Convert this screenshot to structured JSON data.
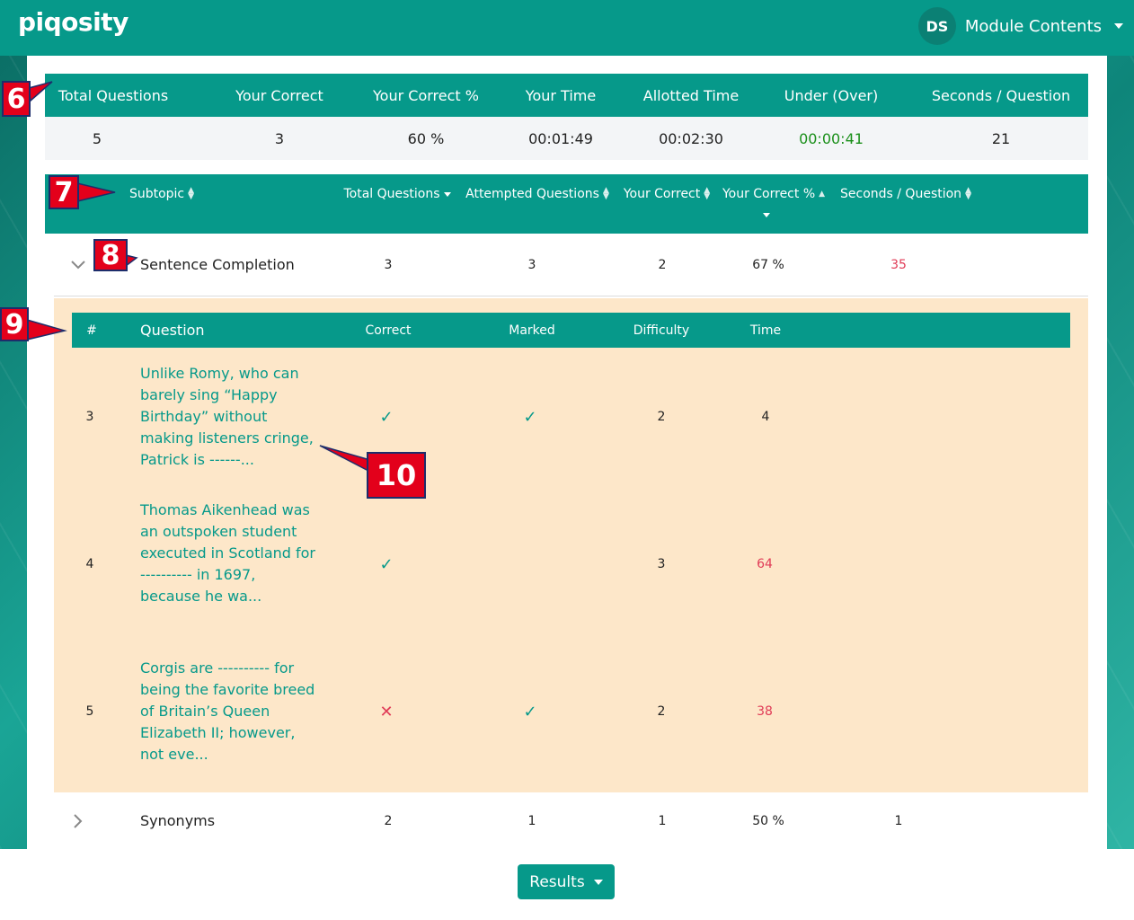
{
  "header": {
    "logo": "piqosity",
    "avatar_initials": "DS",
    "menu_label": "Module Contents"
  },
  "summary": {
    "columns": [
      "Total Questions",
      "Your Correct",
      "Your Correct %",
      "Your Time",
      "Allotted Time",
      "Under (Over)",
      "Seconds / Question"
    ],
    "values": [
      "5",
      "3",
      "60 %",
      "00:01:49",
      "00:02:30",
      "00:00:41",
      "21"
    ]
  },
  "subtopics": {
    "columns": [
      "Subtopic",
      "Total Questions",
      "Attempted Questions",
      "Your Correct",
      "Your Correct %",
      "Seconds / Question"
    ],
    "rows": [
      {
        "name": "Sentence Completion",
        "total": "3",
        "attempted": "3",
        "correct": "2",
        "percent": "67 %",
        "spq": "35"
      },
      {
        "name": "Synonyms",
        "total": "2",
        "attempted": "1",
        "correct": "1",
        "percent": "50 %",
        "spq": "1"
      }
    ]
  },
  "questions": {
    "columns": [
      "#",
      "Question",
      "Correct",
      "Marked",
      "Difficulty",
      "Time"
    ],
    "rows": [
      {
        "num": "3",
        "text": "Unlike Romy, who can barely sing “Happy Birthday” without making listeners cringe, Patrick is ------...",
        "correct": "check",
        "marked": "check",
        "difficulty": "2",
        "time": "4"
      },
      {
        "num": "4",
        "text": "Thomas Aikenhead was an outspoken student executed in Scotland for ---------- in 1697, because he wa...",
        "correct": "check",
        "marked": "",
        "difficulty": "3",
        "time": "64"
      },
      {
        "num": "5",
        "text": "Corgis are ---------- for being the favorite breed of Britain’s Queen Elizabeth II; however, not eve...",
        "correct": "cross",
        "marked": "check",
        "difficulty": "2",
        "time": "38"
      }
    ]
  },
  "footer": {
    "results_label": "Results"
  },
  "callouts": [
    "6",
    "7",
    "8",
    "9",
    "10"
  ],
  "colors": {
    "teal": "#06998a",
    "detail_bg": "#fde7c9",
    "red": "#e03b56",
    "green": "#1a8f1a",
    "callout": "#e3001b"
  }
}
